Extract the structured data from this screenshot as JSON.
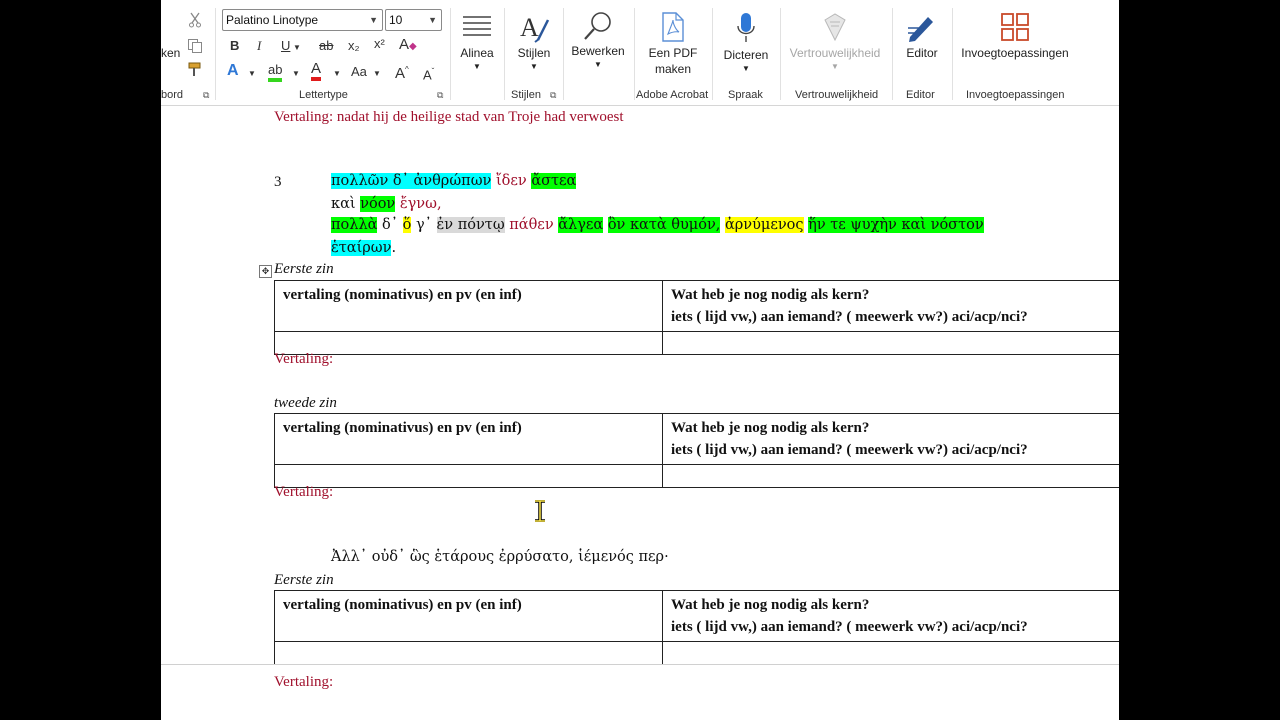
{
  "ribbon": {
    "clipboard": {
      "paste_fragment": "ken",
      "group_label": "bord"
    },
    "font": {
      "font_name": "Palatino Linotype",
      "font_size": "10",
      "bold": "B",
      "italic": "I",
      "underline": "U",
      "strike": "ab",
      "subscript": "x₂",
      "superscript": "x²",
      "clear_format": "A",
      "text_effect": "A",
      "highlight": "ab",
      "font_color": "A",
      "change_case": "Aa",
      "grow": "A",
      "shrink": "A",
      "group_label": "Lettertype"
    },
    "paragraph": {
      "label": "Alinea"
    },
    "styles": {
      "label": "Stijlen",
      "group_label": "Stijlen"
    },
    "editing": {
      "label": "Bewerken"
    },
    "acrobat": {
      "label_line1": "Een PDF",
      "label_line2": "maken",
      "group_label": "Adobe Acrobat"
    },
    "voice": {
      "label": "Dicteren",
      "group_label": "Spraak"
    },
    "sensitivity": {
      "label": "Vertrouwelijkheid",
      "group_label": "Vertrouwelijkheid"
    },
    "editor": {
      "label": "Editor",
      "group_label": "Editor"
    },
    "addins": {
      "label": "Invoegtoepassingen",
      "group_label": "Invoegtoepassingen"
    },
    "accent_color": "#2b579a"
  },
  "document": {
    "translation_top": "Vertaling: nadat hij de heilige stad van Troje had verwoest",
    "line_number": "3",
    "greek": {
      "l1_a": "πολλῶν δ᾽ ἀνθρώπων",
      "l1_b": "ἴδεν",
      "l1_c": "ἄστεα",
      "l2_a": "καὶ",
      "l2_b": "νόον",
      "l2_c": "ἔγνω,",
      "l3_a": "πολλὰ",
      "l3_b": "δ᾽",
      "l3_c": "ὅ",
      "l3_d": "γ᾽",
      "l3_e": "ἐν πόντῳ",
      "l3_f": "πάθεν",
      "l3_g": "ἄλγεα",
      "l3_h": "ὃν κατὰ θυμόν,",
      "l3_i": "ἀρνύμενος",
      "l3_j": "ἥν τε ψυχὴν καὶ νόστον",
      "l4_a": "ἑταίρων",
      "l4_b": "."
    },
    "greek_line5": "Ἀλλ᾽ οὐδ᾽ ὣς ἑτάρους ἐρρύσατο, ἱέμενός περ·",
    "section1_title": "Eerste zin",
    "section2_title": "tweede zin",
    "section3_title": "Eerste zin",
    "table_header_left": "vertaling (nominativus) en pv (en inf)",
    "table_header_right_1": "Wat heb je nog nodig als kern?",
    "table_header_right_2": "iets (  lijd vw,) aan iemand? (  meewerk vw?) aci/acp/nci?",
    "vertaling_label": "Vertaling:",
    "table_move_handle": "✥"
  },
  "colors": {
    "translation_red": "#a0102c",
    "highlight_cyan": "#00ffff",
    "highlight_green": "#00ff00",
    "highlight_yellow": "#ffff00",
    "highlight_gray": "#d9d9d9"
  }
}
